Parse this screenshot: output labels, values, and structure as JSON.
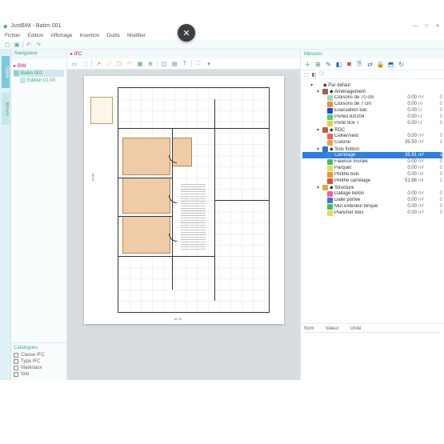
{
  "window": {
    "title": "JustBIM - Batim 001"
  },
  "wincontrols": {
    "min": "—",
    "max": "□",
    "close": "✕"
  },
  "menu": [
    "Fichier",
    "Edition",
    "Affichage",
    "Insertion",
    "Outils",
    "Modifier"
  ],
  "sidetabs": [
    "Objets",
    "Mesure"
  ],
  "navigator": {
    "title": "Navigateur",
    "tabtitle": "BIM",
    "items": [
      {
        "label": "Batim 001"
      },
      {
        "label": "Edition 01.00"
      }
    ],
    "bottom_title": "Catalogues",
    "bottom": [
      {
        "label": "Classe IFC",
        "checked": false
      },
      {
        "label": "Type IFC",
        "checked": false
      },
      {
        "label": "Matériaux",
        "checked": false
      },
      {
        "label": "Site",
        "checked": false
      }
    ]
  },
  "center": {
    "tab1": "IFC",
    "tab2": "+"
  },
  "results": {
    "title": "Mesures",
    "tabs": [
      "⬚",
      "◧",
      "🗀"
    ],
    "root": "Par défaut",
    "groups": [
      {
        "name": "Aménagement",
        "color": "#a06050",
        "children": [
          {
            "name": "Cloisons de 70 cm",
            "color": "#9adfc0",
            "v1": "0.00",
            "unit": "m²",
            "v2": "0"
          },
          {
            "name": "Cloisons de 7 cm",
            "color": "#f09030",
            "v1": "0.00",
            "unit": "m",
            "v2": "0"
          },
          {
            "name": "Evacuation bac",
            "color": "#3040e0",
            "v1": "0.00",
            "unit": "U",
            "v2": "0"
          },
          {
            "name": "Portes 83/204",
            "color": "#50d060",
            "v1": "0.00",
            "unit": "U",
            "v2": "0"
          },
          {
            "name": "Porte 90x T",
            "color": "#e0d040",
            "v1": "0.00",
            "unit": "U",
            "v2": "0"
          }
        ]
      },
      {
        "name": "RDC",
        "color": "#c06030",
        "children": [
          {
            "name": "Cellier/vest",
            "color": "#f06060",
            "v1": "0.00",
            "unit": "m²",
            "v2": "0"
          },
          {
            "name": "Cuisine",
            "color": "#f0a040",
            "v1": "35.50",
            "unit": "m²",
            "v2": "1"
          }
        ]
      },
      {
        "name": "Sols finition",
        "color": "#3070d0",
        "children": [
          {
            "name": "Carrelage",
            "color": "#4080e0",
            "v1": "35.91",
            "unit": "m²",
            "v2": "1",
            "selected": true
          },
          {
            "name": "Faïence murale",
            "color": "#40c060",
            "v1": "0.00",
            "unit": "m²",
            "v2": "0"
          },
          {
            "name": "Parquet",
            "color": "#e0e050",
            "v1": "0.00",
            "unit": "m²",
            "v2": "0"
          },
          {
            "name": "Plinthe bois",
            "color": "#f09030",
            "v1": "0.00",
            "unit": "ml",
            "v2": "0"
          },
          {
            "name": "Plinthe carrelage",
            "color": "#e05030",
            "v1": "51.86",
            "unit": "ml",
            "v2": "1"
          }
        ]
      },
      {
        "name": "Structure",
        "color": "#d0b040",
        "children": [
          {
            "name": "Dallage béton",
            "color": "#f060a0",
            "v1": "0.00",
            "unit": "m²",
            "v2": "0"
          },
          {
            "name": "Dalle portée",
            "color": "#4070e0",
            "v1": "0.00",
            "unit": "m²",
            "v2": "0"
          },
          {
            "name": "Mur extérieur Brique",
            "color": "#40c060",
            "v1": "0.00",
            "unit": "m²",
            "v2": "0"
          },
          {
            "name": "Plancher bois",
            "color": "#e0e050",
            "v1": "0.00",
            "unit": "m²",
            "v2": "0"
          }
        ]
      }
    ]
  },
  "props": {
    "col1": "Nom",
    "col2": "Valeur",
    "col3": "Unité"
  },
  "overlay": {
    "x": "✕"
  }
}
